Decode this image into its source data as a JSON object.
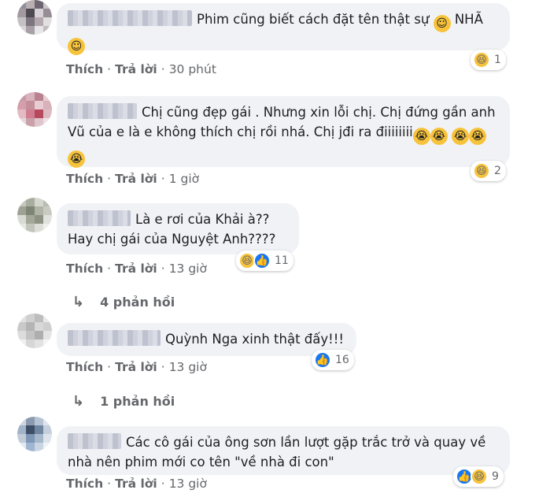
{
  "comments": [
    {
      "text": "Phim cũng biết cách đặt tên thật sự",
      "text_tail": "NHÃ",
      "reaction_count": "1",
      "actions": {
        "like": "Thích",
        "reply": "Trả lời",
        "time": "30 phút"
      }
    },
    {
      "text": "Chị cũng đẹp gái . Nhưng xin lỗi chị. Chị đứng gần anh Vũ của e là e không thích chị rồi nhá. Chị jđi ra điiiiiiii",
      "reaction_count": "2",
      "actions": {
        "like": "Thích",
        "reply": "Trả lời",
        "time": "1 giờ"
      }
    },
    {
      "text_line1": "Là e rơi của Khải à??",
      "text_line2": "Hay chị gái của Nguyệt Anh????",
      "reaction_count": "11",
      "actions": {
        "like": "Thích",
        "reply": "Trả lời",
        "time": "13 giờ"
      },
      "replies": "4 phản hồi"
    },
    {
      "text": "Quỳnh Nga xinh thật đấy!!!",
      "reaction_count": "16",
      "actions": {
        "like": "Thích",
        "reply": "Trả lời",
        "time": "13 giờ"
      },
      "replies": "1 phản hồi"
    },
    {
      "text": "Các cô gái của ông sơn lần lượt gặp trắc trở và quay về nhà nên phim mới co tên \"về nhà đi con\"",
      "reaction_count": "9",
      "actions": {
        "like": "Thích",
        "reply": "Trả lời",
        "time": "13 giờ"
      }
    }
  ],
  "separator": "·",
  "icons": {
    "haha": "haha-emoji-icon",
    "like": "like-icon",
    "smile": "smile-emoji-icon",
    "cry": "crying-emoji-icon",
    "reply_arrow": "reply-arrow-icon"
  },
  "colors": {
    "bubble": "#f0f2f5",
    "meta": "#65676b",
    "like_blue": "#1877f2",
    "haha_yellow": "#f7c33b"
  }
}
